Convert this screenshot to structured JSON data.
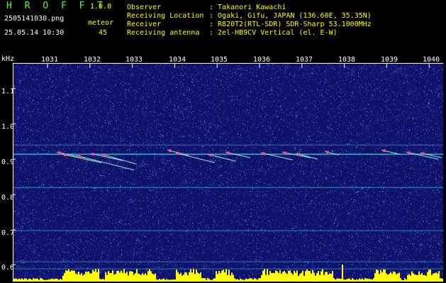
{
  "header": {
    "title": "H R O F F T",
    "version": "1.0.0",
    "filename": "2505141030.png",
    "datetime": "25.05.14 10:30",
    "meteor_label": "meteor",
    "meteor_count": "45",
    "rows": [
      {
        "label": "Observer",
        "value": ": Takanori Kawachi"
      },
      {
        "label": "Receiving Location",
        "value": ": Ogaki, Gifu, JAPAN (136.60E, 35.35N)"
      },
      {
        "label": "Receiver",
        "value": ": R820T2(RTL-SDR) SDR-Sharp 53.1000MHz"
      },
      {
        "label": "Receiving antenna",
        "value": ": 2el-HB9CV Vertical (el. E-W)"
      }
    ]
  },
  "axis": {
    "unit": "kHz",
    "y_ticks": [
      "1.1",
      "1.0",
      "0.9",
      "0.8",
      "0.7",
      "0.6"
    ],
    "x_ticks": [
      "1031",
      "1032",
      "1033",
      "1034",
      "1035",
      "1036",
      "1037",
      "1038",
      "1039",
      "1040"
    ]
  },
  "colors": {
    "background": "#10126a",
    "carrier_line": "#3fd0e0",
    "meteor_echo": "#ff4a8a",
    "activity_bar": "#ffff00",
    "label": "#ffffff",
    "header_text": "#ffff00",
    "title_text": "#4cff4c"
  }
}
